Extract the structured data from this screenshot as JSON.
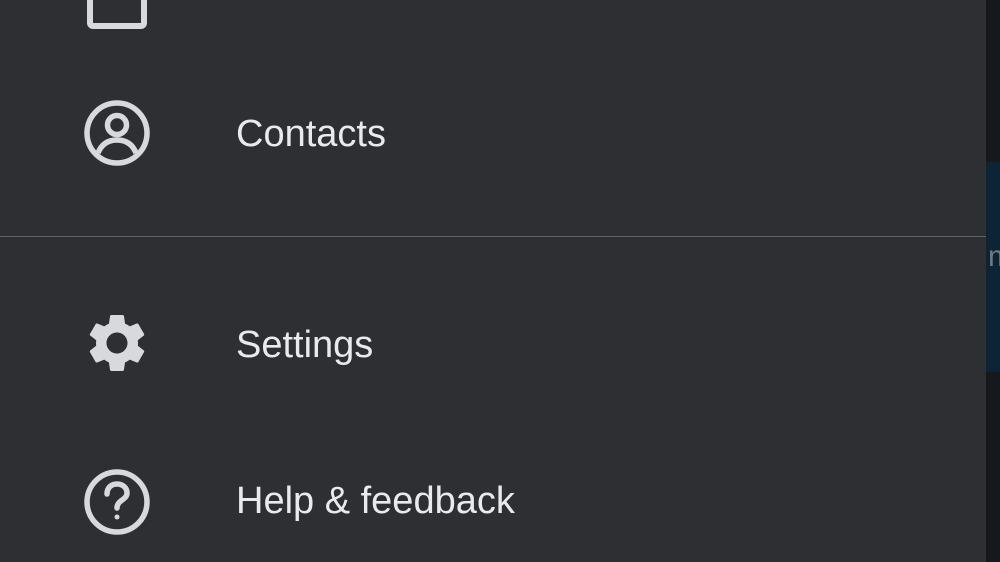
{
  "drawer": {
    "items": [
      {
        "id": "top-partial",
        "icon": "calendar-icon",
        "label": ""
      },
      {
        "id": "contacts",
        "icon": "account-circle-icon",
        "label": "Contacts"
      },
      {
        "id": "settings",
        "icon": "gear-icon",
        "label": "Settings"
      },
      {
        "id": "help",
        "icon": "help-circle-icon",
        "label": "Help & feedback"
      }
    ]
  },
  "background": {
    "partial_text": "m"
  },
  "colors": {
    "drawer_bg": "#2d2f32",
    "text": "#e8eaed",
    "icon": "#d7d9dc",
    "divider": "#5f6368"
  }
}
